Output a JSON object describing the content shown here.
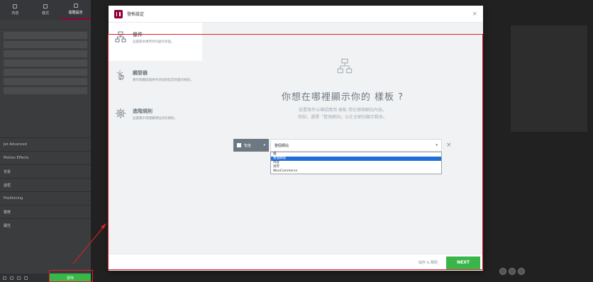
{
  "panel": {
    "tabs": [
      {
        "label": "內容",
        "icon": "pencil-icon"
      },
      {
        "label": "樣式",
        "icon": "halfcircle-icon"
      },
      {
        "label": "進階設定",
        "icon": "gear-icon"
      }
    ],
    "sections": [
      "Jet Advanced",
      "Motion Effects",
      "背景",
      "邊框",
      "Positioning",
      "響應",
      "屬性"
    ],
    "update_label": "發佈"
  },
  "modal": {
    "title": "發佈設定",
    "close": "×",
    "sidebar": [
      {
        "title": "條件",
        "desc": "設置範本應用到何處的頁面。",
        "icon": "sitemap-icon",
        "active": true
      },
      {
        "title": "觸發器",
        "desc": "將作者觸發器條件添加到指定頁面的規則。",
        "icon": "pointer-icon",
        "active": false
      },
      {
        "title": "進階規則",
        "desc": "設置顯示或隱藏彈出式的規則。",
        "icon": "cog-icon",
        "active": false
      }
    ],
    "heading": "你想在哪裡顯示你的 樣板 ?",
    "subtext_1": "設置條件以確認應用 樣板 用在哪個網站內容。",
    "subtext_2": "例如，選擇「整個網站」以在全網站顯示範本。",
    "include_label": "包含",
    "condition_value": "整個網站",
    "dropdown_options": [
      "檔",
      "整個網站",
      "內容",
      "封存",
      "WooCommerce"
    ],
    "dropdown_selected_index": 1,
    "skip_label": "儲存 & 關閉",
    "next_label": "NEXT"
  },
  "colors": {
    "accent": "#92003b",
    "green": "#39b54a",
    "annotation": "#e0202a"
  }
}
